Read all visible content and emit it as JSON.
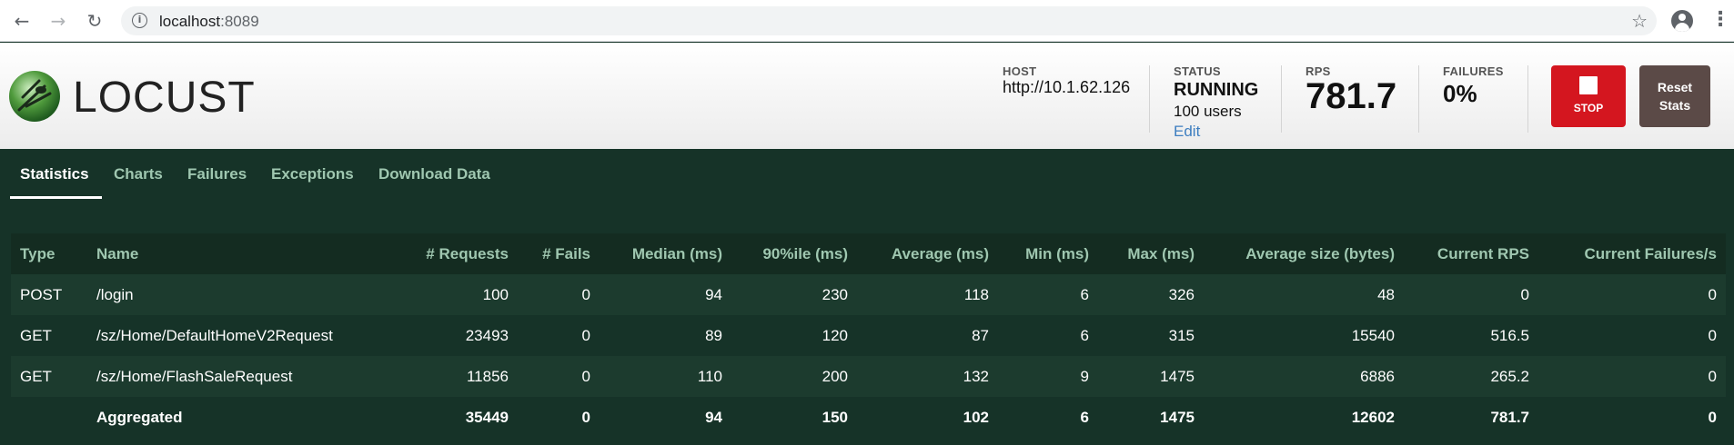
{
  "browser": {
    "url_host": "localhost",
    "url_port": ":8089"
  },
  "header": {
    "logo_text": "LOCUST",
    "host": {
      "label": "HOST",
      "value": "http://10.1.62.126"
    },
    "status": {
      "label": "STATUS",
      "value": "RUNNING",
      "users": "100 users",
      "edit": "Edit"
    },
    "rps": {
      "label": "RPS",
      "value": "781.7"
    },
    "failures": {
      "label": "FAILURES",
      "value": "0%"
    },
    "stop_label": "STOP",
    "reset_label_1": "Reset",
    "reset_label_2": "Stats"
  },
  "tabs": [
    {
      "label": "Statistics",
      "active": true
    },
    {
      "label": "Charts"
    },
    {
      "label": "Failures"
    },
    {
      "label": "Exceptions"
    },
    {
      "label": "Download Data"
    }
  ],
  "table": {
    "columns": [
      "Type",
      "Name",
      "# Requests",
      "# Fails",
      "Median (ms)",
      "90%ile (ms)",
      "Average (ms)",
      "Min (ms)",
      "Max (ms)",
      "Average size (bytes)",
      "Current RPS",
      "Current Failures/s"
    ],
    "rows": [
      [
        "POST",
        "/login",
        "100",
        "0",
        "94",
        "230",
        "118",
        "6",
        "326",
        "48",
        "0",
        "0"
      ],
      [
        "GET",
        "/sz/Home/DefaultHomeV2Request",
        "23493",
        "0",
        "89",
        "120",
        "87",
        "6",
        "315",
        "15540",
        "516.5",
        "0"
      ],
      [
        "GET",
        "/sz/Home/FlashSaleRequest",
        "11856",
        "0",
        "110",
        "200",
        "132",
        "9",
        "1475",
        "6886",
        "265.2",
        "0"
      ]
    ],
    "aggregated": [
      "",
      "Aggregated",
      "35449",
      "0",
      "94",
      "150",
      "102",
      "6",
      "1475",
      "12602",
      "781.7",
      "0"
    ]
  },
  "colors": {
    "background": "#163328",
    "tab_text": "#9fc7b0",
    "stop_button": "#d4161f",
    "reset_button": "#5b4a47",
    "edit_link": "#3d7ec0"
  }
}
